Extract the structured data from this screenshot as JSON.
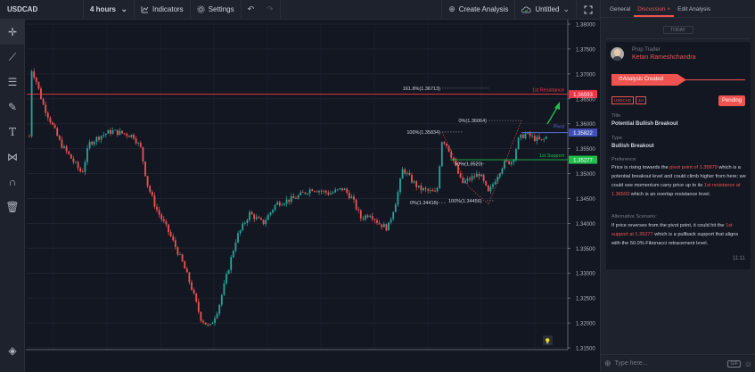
{
  "topbar": {
    "symbol": "USDCAD",
    "interval": "4 hours",
    "indicators_label": "Indicators",
    "settings_label": "Settings",
    "create_analysis_label": "Create Analysis",
    "layout_name": "Untitled"
  },
  "chart": {
    "price_labels": [
      "1.38000",
      "1.37500",
      "1.37000",
      "1.36500",
      "1.36000",
      "1.35500",
      "1.35000",
      "1.34500",
      "1.34000",
      "1.33500",
      "1.33000",
      "1.32500",
      "1.32000",
      "1.31500"
    ],
    "resistance": {
      "label": "1st Resistance",
      "price_tag": "1.36593"
    },
    "pivot": {
      "label": "Pivot",
      "price_tag": "1.35822"
    },
    "support": {
      "label": "1st Support",
      "price_tag": "1.35277"
    },
    "fib_upper": {
      "level_161": "161.8%(1.36713)",
      "level_0": "0%(1.36064)",
      "level_100": "100%(1.35834)"
    },
    "fib_lower": {
      "level_50": "50%(1.3520)",
      "level_0": "0%(1.34415)",
      "level_100": "100%(1.34456)"
    },
    "colors": {
      "up": "#26a69a",
      "down": "#ef5350",
      "resistance": "#f23645",
      "pivot": "#5b6fd6",
      "support": "#1fbf4a",
      "arrow": "#1fbf4a"
    }
  },
  "panel": {
    "tabs": [
      "General",
      "Discussion",
      "Edit Analysis"
    ],
    "tab_close": "×",
    "today_label": "TODAY",
    "role": "Prop Trader",
    "author": "Ketan Rameshchandra",
    "analysis_created": "Analysis Created",
    "badges": [
      "USDCAD",
      "4H"
    ],
    "status": "Pending",
    "title_label": "Title",
    "title_value": "Potential Bullish Breakout",
    "type_label": "Type",
    "type_value": "Bullish Breakout",
    "preference_label": "Preference:",
    "preference_text": {
      "p1": "Price is rising towards the ",
      "h1": "pivot point of 1.35879",
      "p2": " which is a potential breakout level and could climb higher from here; we could see momentum carry price up to its ",
      "h2": "1st resistance at 1.36593",
      "p3": " which is an overlap resistance level."
    },
    "alternative_label": "Alternative Scenario:",
    "alternative_text": {
      "p1": "If price reverses from the pivot point, it could hit the ",
      "h1": "1st support at 1.35277",
      "p2": " which is a pullback support that aligns with the 50.0% Fibonacci retracement level."
    },
    "time": "11:11",
    "reply_placeholder": "Type here...",
    "gif_label": "GIF"
  }
}
